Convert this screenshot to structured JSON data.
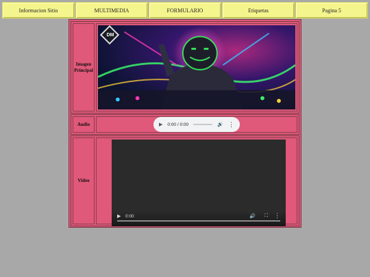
{
  "nav": {
    "items": [
      {
        "label": "Informacion Sitio"
      },
      {
        "label": "MULTIMEDIA"
      },
      {
        "label": "FORMULARIO"
      },
      {
        "label": "Etiquetas"
      },
      {
        "label": "Pagina 5"
      }
    ]
  },
  "rows": {
    "image": {
      "label": "Imagen Principal",
      "logo_text": "DM"
    },
    "audio": {
      "label": "Audio",
      "time": "0:00 / 0:00"
    },
    "video": {
      "label": "Video",
      "time": "0:00"
    }
  },
  "colors": {
    "nav_bg": "#f5f58e",
    "content_bg": "#e0587a",
    "page_bg": "#a8a8a8"
  }
}
